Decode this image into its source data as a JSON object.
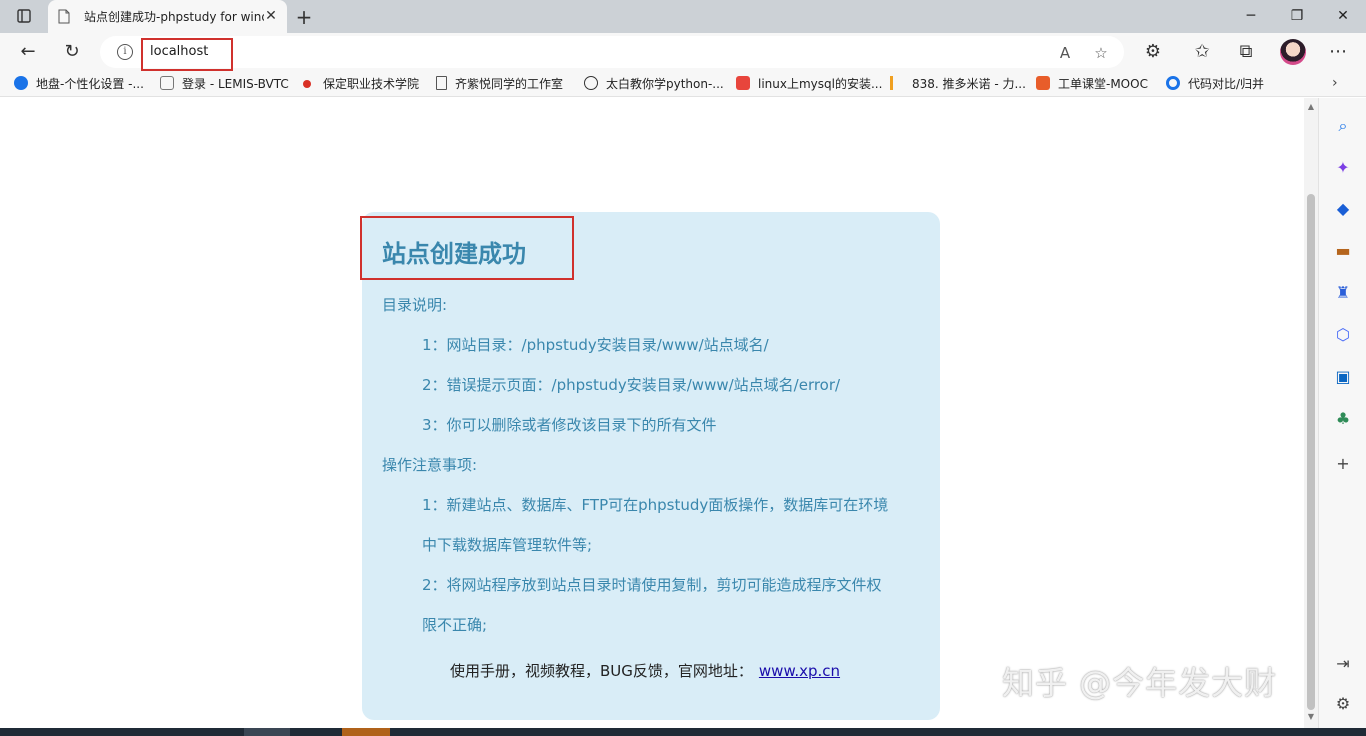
{
  "tab": {
    "title": "站点创建成功-phpstudy for windows",
    "close": "✕",
    "new_tab": "+"
  },
  "window": {
    "minimize": "─",
    "maximize": "❐",
    "close": "✕"
  },
  "address": {
    "url": "localhost",
    "info": "i"
  },
  "bookmarks": [
    {
      "label": "地盘-个性化设置 -...",
      "color": "#1a73e8"
    },
    {
      "label": "登录 - LEMIS-BVTC",
      "color": "#777777"
    },
    {
      "label": "保定职业技术学院",
      "color": "#d93025"
    },
    {
      "label": "齐紫悦同学的工作室",
      "color": "#ffffff"
    },
    {
      "label": "太白教你学python-...",
      "color": "#ffffff"
    },
    {
      "label": "linux上mysql的安装...",
      "color": "#e8453c"
    },
    {
      "label": "838. 推多米诺 - 力...",
      "color": "#f0a020"
    },
    {
      "label": "工单课堂-MOOC",
      "color": "#e85d2a"
    },
    {
      "label": "代码对比/归并",
      "color": "#1a73e8"
    }
  ],
  "page": {
    "heading": "站点创建成功",
    "dir_title": "目录说明:",
    "dir_items": [
      "1：网站目录：/phpstudy安装目录/www/站点域名/",
      "2：错误提示页面：/phpstudy安装目录/www/站点域名/error/",
      "3：你可以删除或者修改该目录下的所有文件"
    ],
    "ops_title": "操作注意事项:",
    "ops_item1_line1": "1：新建站点、数据库、FTP可在phpstudy面板操作，数据库可在环境",
    "ops_item1_line2": "中下载数据库管理软件等;",
    "ops_item2_line1": "2：将网站程序放到站点目录时请使用复制，剪切可能造成程序文件权",
    "ops_item2_line2": "限不正确;",
    "footer_text": "使用手册，视频教程，BUG反馈，官网地址：",
    "footer_link": "www.xp.cn"
  },
  "watermark": "知乎 @今年发大财",
  "colors": {
    "accent": "#3a87ad",
    "card_bg": "#d9edf7",
    "highlight": "#d0312d"
  }
}
